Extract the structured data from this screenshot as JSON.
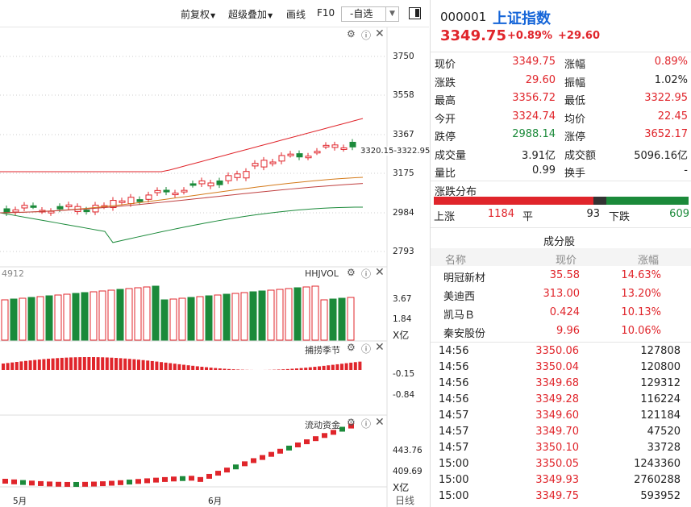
{
  "toolbar": {
    "fuquan": "前复权",
    "chaoji": "超级叠加",
    "huaxian": "画线",
    "f10": "F10",
    "zixuan": "-自选"
  },
  "colors": {
    "up": "#e0252b",
    "down": "#1b8a3a",
    "accent_blue": "#1565d8"
  },
  "kline": {
    "price_ticks": [
      "3750",
      "3558",
      "3367",
      "3175",
      "2984",
      "2793"
    ],
    "range_label": "3320.15-3322.95"
  },
  "vol_panel": {
    "title": "HHJVOL",
    "left_value": "4912",
    "ticks": [
      "3.67",
      "1.84"
    ],
    "unit": "X亿"
  },
  "macd_panel": {
    "title": "捕捞季节",
    "ticks": [
      "-0.15",
      "-0.84"
    ]
  },
  "flow_panel": {
    "title": "流动资金",
    "ticks": [
      "443.76",
      "409.69"
    ],
    "unit": "X亿"
  },
  "date_axis": {
    "may": "5月",
    "june": "6月",
    "period": "日线"
  },
  "stock": {
    "code": "000001",
    "name": "上证指数",
    "price": "3349.75",
    "pct": "+0.89%",
    "change": "+29.60"
  },
  "quote": [
    {
      "k1": "现价",
      "v1": "3349.75",
      "c1": "red",
      "k2": "涨幅",
      "v2": "0.89%",
      "c2": "red"
    },
    {
      "k1": "涨跌",
      "v1": "29.60",
      "c1": "red",
      "k2": "振幅",
      "v2": "1.02%",
      "c2": ""
    },
    {
      "k1": "最高",
      "v1": "3356.72",
      "c1": "red",
      "k2": "最低",
      "v2": "3322.95",
      "c2": "red"
    },
    {
      "k1": "今开",
      "v1": "3324.74",
      "c1": "red",
      "k2": "均价",
      "v2": "22.45",
      "c2": "red"
    },
    {
      "k1": "跌停",
      "v1": "2988.14",
      "c1": "green",
      "k2": "涨停",
      "v2": "3652.17",
      "c2": "red"
    },
    {
      "k1": "成交量",
      "v1": "3.91亿",
      "c1": "",
      "k2": "成交额",
      "v2": "5096.16亿",
      "c2": ""
    },
    {
      "k1": "量比",
      "v1": "0.99",
      "c1": "",
      "k2": "换手",
      "v2": "-",
      "c2": ""
    }
  ],
  "breadth": {
    "title": "涨跌分布",
    "up_label": "上涨",
    "up": "1184",
    "flat_label": "平",
    "flat": "93",
    "down_label": "下跌",
    "down": "609"
  },
  "components": {
    "title": "成分股",
    "headers": [
      "名称",
      "现价",
      "涨幅"
    ],
    "rows": [
      {
        "name": "明冠新材",
        "price": "35.58",
        "pct": "14.63%"
      },
      {
        "name": "美迪西",
        "price": "313.00",
        "pct": "13.20%"
      },
      {
        "name": "凯马Ｂ",
        "price": "0.424",
        "pct": "10.13%"
      },
      {
        "name": "秦安股份",
        "price": "9.96",
        "pct": "10.06%"
      }
    ]
  },
  "ticks": [
    {
      "t": "14:56",
      "p": "3350.06",
      "v": "127808"
    },
    {
      "t": "14:56",
      "p": "3350.04",
      "v": "120800"
    },
    {
      "t": "14:56",
      "p": "3349.68",
      "v": "129312"
    },
    {
      "t": "14:56",
      "p": "3349.28",
      "v": "116224"
    },
    {
      "t": "14:57",
      "p": "3349.60",
      "v": "121184"
    },
    {
      "t": "14:57",
      "p": "3349.70",
      "v": "47520"
    },
    {
      "t": "14:57",
      "p": "3350.10",
      "v": "33728"
    },
    {
      "t": "15:00",
      "p": "3350.05",
      "v": "1243360"
    },
    {
      "t": "15:00",
      "p": "3349.93",
      "v": "2760288"
    },
    {
      "t": "15:00",
      "p": "3349.75",
      "v": "593952"
    }
  ]
}
